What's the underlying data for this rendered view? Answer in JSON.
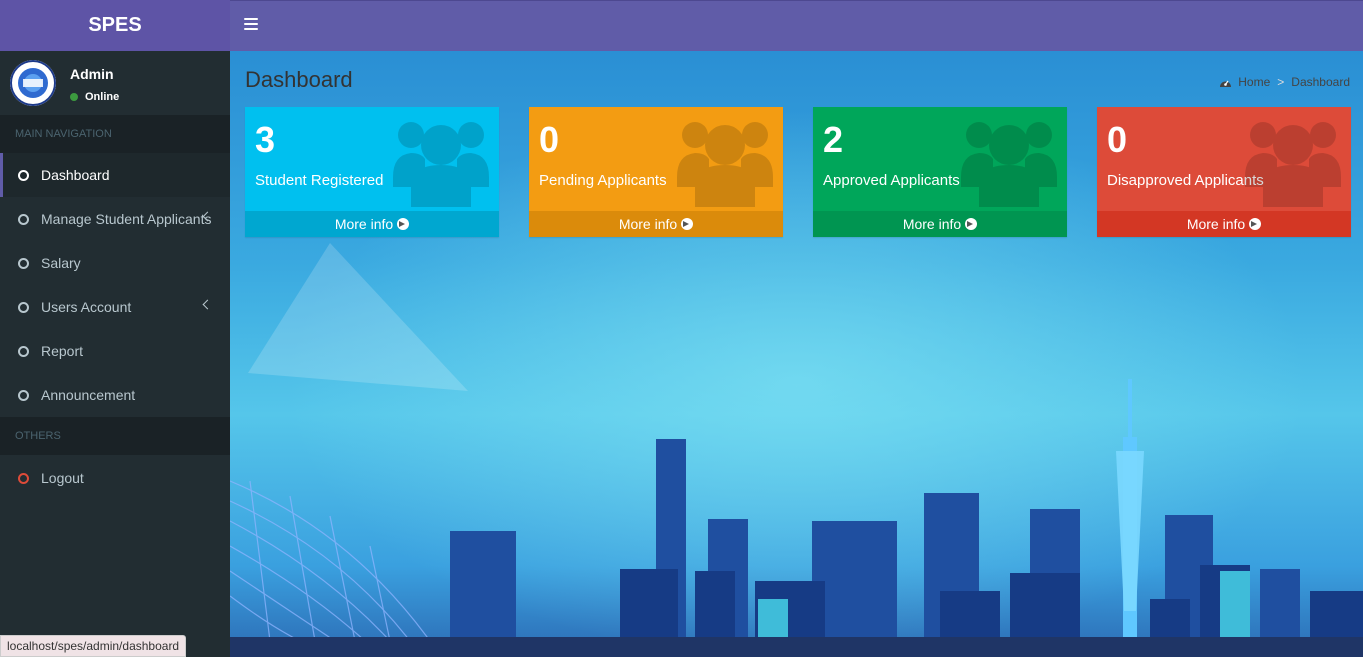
{
  "app": {
    "title": "SPES"
  },
  "user": {
    "name": "Admin",
    "status": "Online"
  },
  "nav": {
    "main_header": "MAIN NAVIGATION",
    "items": [
      {
        "label": "Dashboard",
        "active": true
      },
      {
        "label": "Manage Student Applicants",
        "has_submenu": true
      },
      {
        "label": "Salary"
      },
      {
        "label": "Users Account",
        "has_submenu": true
      },
      {
        "label": "Report"
      },
      {
        "label": "Announcement"
      }
    ],
    "others_header": "OTHERS",
    "logout": "Logout"
  },
  "page": {
    "title": "Dashboard"
  },
  "breadcrumb": {
    "home": "Home",
    "current": "Dashboard"
  },
  "boxes": [
    {
      "value": "3",
      "label": "Student Registered",
      "link": "More info",
      "color": "#00c0ef"
    },
    {
      "value": "0",
      "label": "Pending Applicants",
      "link": "More info",
      "color": "#f39c12"
    },
    {
      "value": "2",
      "label": "Approved Applicants",
      "link": "More info",
      "color": "#00a65a"
    },
    {
      "value": "0",
      "label": "Disapproved Applicants",
      "link": "More info",
      "color": "#dd4b39"
    }
  ],
  "statusbar": {
    "url": "localhost/spes/admin/dashboard"
  },
  "colors": {
    "header": "#605ca8",
    "sidebar": "#222d32"
  },
  "icons": [
    "menu-icon",
    "circle-icon",
    "chevron-left-icon",
    "dashboard-icon",
    "users-icon",
    "arrow-circle-right-icon"
  ]
}
